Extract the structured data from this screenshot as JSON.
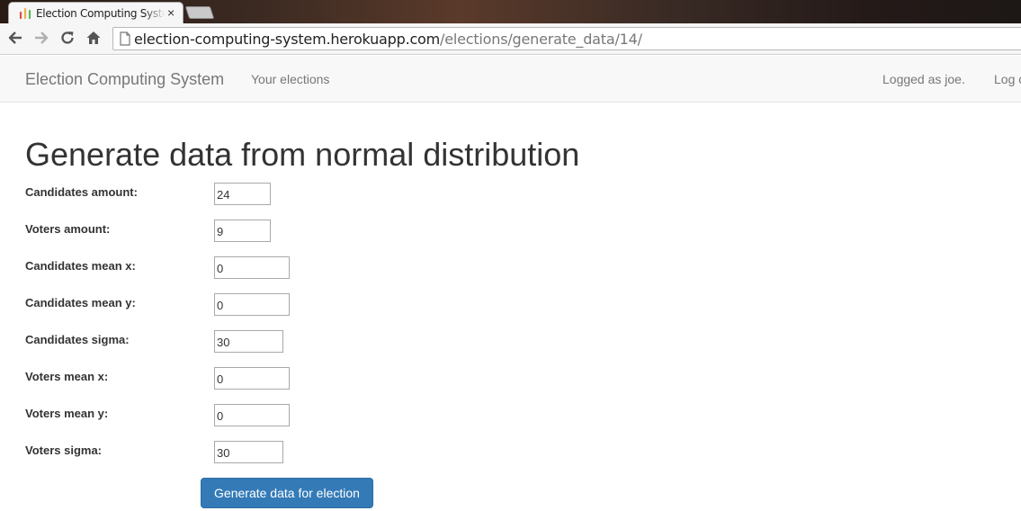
{
  "browser": {
    "tab_title": "Election Computing System",
    "tab_close": "×",
    "url_host": "election-computing-system.herokuapp.com",
    "url_path": "/elections/generate_data/14/",
    "icons": {
      "back": "back-arrow-icon",
      "forward": "forward-arrow-icon",
      "reload": "reload-icon",
      "home": "home-icon",
      "page": "page-icon",
      "favicon": "site-favicon-icon"
    }
  },
  "navbar": {
    "brand": "Election Computing System",
    "your_elections": "Your elections",
    "logged_as": "Logged as joe.",
    "logout": "Log out"
  },
  "form": {
    "title": "Generate data from normal distribution",
    "fields": [
      {
        "label": "Candidates amount:",
        "value": "24"
      },
      {
        "label": "Voters amount:",
        "value": "9"
      },
      {
        "label": "Candidates mean x:",
        "value": "0"
      },
      {
        "label": "Candidates mean y:",
        "value": "0"
      },
      {
        "label": "Candidates sigma:",
        "value": "30"
      },
      {
        "label": "Voters mean x:",
        "value": "0"
      },
      {
        "label": "Voters mean y:",
        "value": "0"
      },
      {
        "label": "Voters sigma:",
        "value": "30"
      }
    ],
    "submit_label": "Generate data for election"
  },
  "colors": {
    "primary_button": "#337ab7",
    "navbar_bg": "#f8f8f8",
    "navbar_text": "#777777",
    "heading_text": "#333333"
  }
}
